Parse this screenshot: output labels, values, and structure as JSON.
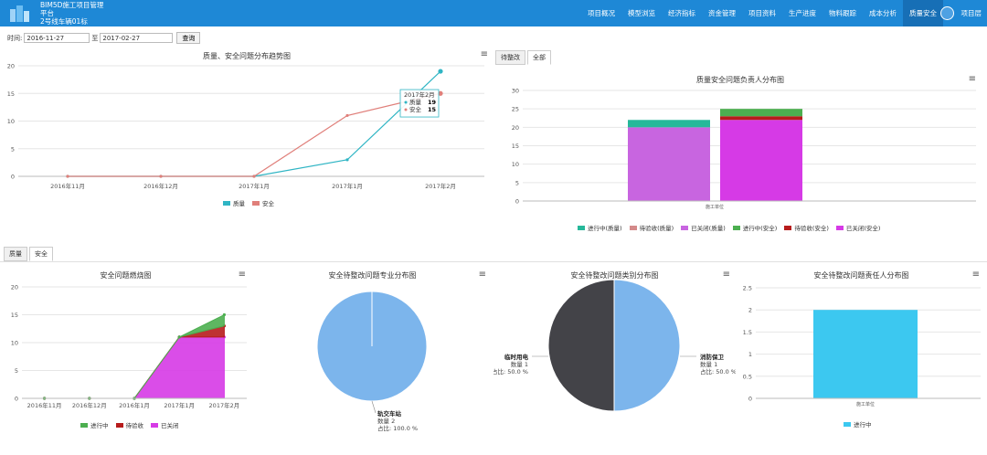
{
  "header": {
    "app_title": "BIM5D施工项目管理平台",
    "project_name": "2号线车辆01标",
    "nav": [
      "项目概况",
      "模型浏览",
      "经济指标",
      "资金管理",
      "项目资料",
      "生产进度",
      "物料跟踪",
      "成本分析",
      "质量安全"
    ],
    "active_nav": "质量安全",
    "user": "项目层",
    "brand_color": "#1e88d6"
  },
  "filter": {
    "label": "时间:",
    "start": "2016-11-27",
    "to": "至",
    "end": "2017-02-27",
    "query_button": "查询"
  },
  "top_tabs": [
    "待整改",
    "全部"
  ],
  "bottom_tabs": [
    "质量",
    "安全"
  ],
  "menu_glyph": "≡",
  "chart_data": [
    {
      "type": "line",
      "title": "质量、安全问题分布趋势图",
      "categories": [
        "2016年11月",
        "2016年12月",
        "2017年1月",
        "2017年1月",
        "2017年2月"
      ],
      "series": [
        {
          "name": "质量",
          "values": [
            0,
            0,
            0,
            3,
            19
          ],
          "color": "#2fb5c4"
        },
        {
          "name": "安全",
          "values": [
            0,
            0,
            0,
            11,
            15
          ],
          "color": "#e07f7a"
        }
      ],
      "ylim": [
        0,
        20
      ],
      "yticks": [
        0,
        5,
        10,
        15,
        20
      ],
      "tooltip": {
        "title": "2017年2月",
        "rows": [
          {
            "name": "质量",
            "value": "19"
          },
          {
            "name": "安全",
            "value": "15"
          }
        ]
      }
    },
    {
      "type": "bar",
      "stacked": true,
      "title": "质量安全问题负责人分布图",
      "categories": [
        "施工单位",
        "施工单位"
      ],
      "series": [
        {
          "name": "进行中(质量)",
          "values": [
            2,
            0
          ],
          "color": "#26b89a"
        },
        {
          "name": "待验收(质量)",
          "values": [
            0,
            0
          ],
          "color": "#d48a8a"
        },
        {
          "name": "已关闭(质量)",
          "values": [
            20,
            0
          ],
          "color": "#c865e0"
        },
        {
          "name": "进行中(安全)",
          "values": [
            0,
            2
          ],
          "color": "#4caf50"
        },
        {
          "name": "待验收(安全)",
          "values": [
            0,
            1
          ],
          "color": "#b71c1c"
        },
        {
          "name": "已关闭(安全)",
          "values": [
            0,
            22
          ],
          "color": "#d63ae6"
        }
      ],
      "ylim": [
        0,
        30
      ],
      "yticks": [
        0,
        5,
        10,
        15,
        20,
        25,
        30
      ],
      "xlabel": "施工单位"
    },
    {
      "type": "area",
      "title": "安全问题燃烧图",
      "categories": [
        "2016年11月",
        "2016年12月",
        "2016年1月",
        "2017年1月",
        "2017年2月"
      ],
      "series": [
        {
          "name": "进行中",
          "values": [
            0,
            0,
            0,
            0,
            2
          ],
          "color": "#4caf50"
        },
        {
          "name": "待验收",
          "values": [
            0,
            0,
            0,
            0,
            2
          ],
          "color": "#b71c1c"
        },
        {
          "name": "已关闭",
          "values": [
            0,
            0,
            0,
            11,
            11
          ],
          "color": "#d63ae6"
        }
      ],
      "ylim": [
        0,
        20
      ],
      "yticks": [
        0,
        5,
        10,
        15,
        20
      ]
    },
    {
      "type": "pie",
      "title": "安全待整改问题专业分布图",
      "slices": [
        {
          "name": "轨交车站",
          "count_label": "数量 2",
          "pct_label": "占比: 100.0 %",
          "value": 100,
          "color": "#7cb5ec"
        }
      ]
    },
    {
      "type": "pie",
      "title": "安全待整改问题类别分布图",
      "slices": [
        {
          "name": "消防保卫",
          "count_label": "数量 1",
          "pct_label": "占比: 50.0 %",
          "value": 50,
          "color": "#7cb5ec"
        },
        {
          "name": "临时用电",
          "count_label": "数量 1",
          "pct_label": "占比: 50.0 %",
          "value": 50,
          "color": "#434348"
        }
      ]
    },
    {
      "type": "bar",
      "title": "安全待整改问题责任人分布图",
      "categories": [
        "施工单位"
      ],
      "series": [
        {
          "name": "进行中",
          "values": [
            2
          ],
          "color": "#3cc8f0"
        }
      ],
      "ylim": [
        0,
        2.5
      ],
      "yticks": [
        0,
        0.5,
        1,
        1.5,
        2,
        2.5
      ]
    }
  ]
}
